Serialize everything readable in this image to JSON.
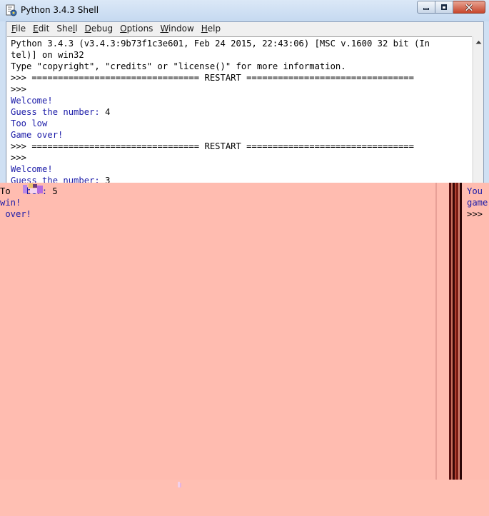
{
  "window": {
    "title": "Python 3.4.3 Shell",
    "icon": "python-idle-icon"
  },
  "menu": {
    "items": [
      {
        "key": "F",
        "rest": "ile"
      },
      {
        "key": "E",
        "rest": "dit"
      },
      {
        "key": "",
        "pre": "She",
        "key2": "l",
        "rest": "l"
      },
      {
        "key": "D",
        "rest": "ebug"
      },
      {
        "key": "O",
        "rest": "ptions"
      },
      {
        "key": "W",
        "rest": "indow"
      },
      {
        "key": "H",
        "rest": "elp"
      }
    ]
  },
  "shell": {
    "lines": [
      {
        "text": "Python 3.4.3 (v3.4.3:9b73f1c3e601, Feb 24 2015, 22:43:06) [MSC v.1600 32 bit (In",
        "style": "out"
      },
      {
        "text": "tel)] on win32",
        "style": "out"
      },
      {
        "text": "Type \"copyright\", \"credits\" or \"license()\" for more information.",
        "style": "out"
      },
      {
        "text": ">>> ================================ RESTART ================================",
        "style": "out"
      },
      {
        "text": ">>>",
        "style": "out"
      },
      {
        "text": "Welcome!",
        "style": "blue"
      },
      {
        "text": "Guess the number: 4",
        "style": "mixed",
        "prompt": "Guess the number: ",
        "input": "4"
      },
      {
        "text": "Too low",
        "style": "blue"
      },
      {
        "text": "Game over!",
        "style": "blue"
      },
      {
        "text": ">>> ================================ RESTART ================================",
        "style": "out"
      },
      {
        "text": ">>>",
        "style": "out"
      },
      {
        "text": "Welcome!",
        "style": "blue"
      },
      {
        "text": "Guess the number: 3",
        "style": "mixed",
        "prompt": "Guess the number: ",
        "input": "3"
      }
    ]
  },
  "glitch": {
    "left_lines": [
      {
        "prefix": "To",
        "rest": "   ber: 5",
        "blue_part": "ber: ",
        "black_part": "5"
      },
      {
        "text": "win!",
        "style": "blue"
      },
      {
        "text": " over!",
        "style": "blue"
      }
    ],
    "right_lines": [
      {
        "text": "You",
        "style": "blue"
      },
      {
        "text": "game",
        "style": "blue"
      },
      {
        "text": ">>>",
        "style": "out"
      }
    ]
  },
  "colors": {
    "background": "#ffbcb0",
    "output_text": "#000000",
    "shell_blue": "#1c1ca8",
    "titlebar": "#c5d9f0",
    "close_button": "#c7462c"
  }
}
